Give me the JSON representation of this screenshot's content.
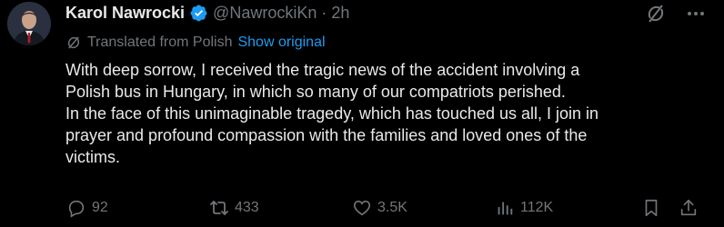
{
  "author": {
    "display_name": "Karol Nawrocki",
    "handle": "@NawrockiKn",
    "separator": "·",
    "time": "2h",
    "verified_color": "#1d9bf0"
  },
  "translation": {
    "label": "Translated from Polish",
    "show_original": "Show original"
  },
  "tweet": {
    "text": "With deep sorrow, I received the tragic news of the accident involving a\nPolish bus in Hungary, in which so many of our compatriots perished.\nIn the face of this unimaginable tragedy, which has touched us all, I join in\nprayer and profound compassion with the families and loved ones of the\nvictims."
  },
  "actions": {
    "replies": "92",
    "reposts": "433",
    "likes": "3.5K",
    "views": "112K"
  },
  "icons": {
    "grok": "grok-icon",
    "more": "more-icon",
    "reply": "reply-icon",
    "repost": "repost-icon",
    "like": "heart-icon",
    "views": "views-icon",
    "bookmark": "bookmark-icon",
    "share": "share-icon"
  },
  "colors": {
    "background": "#000000",
    "text": "#e7e9ea",
    "muted": "#71767b",
    "link": "#1d9bf0"
  }
}
